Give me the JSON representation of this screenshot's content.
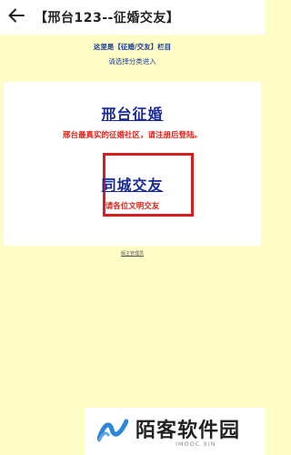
{
  "header": {
    "back_icon": "arrow-left-icon",
    "title": "【邢台123--征婚交友】"
  },
  "intro": {
    "line1": "这里是【征婚/交友】栏目",
    "line2": "请选择分类进入"
  },
  "sections": [
    {
      "title": "邢台征婚",
      "subtitle": "邢台最真实的征婚社区，请注册后登陆。"
    },
    {
      "title": "同城交友",
      "subtitle": "请各位文明交友"
    }
  ],
  "admin_link": "版主管理员",
  "watermark": {
    "name": "陌客软件园",
    "sub": "IMOOC XIN",
    "logo_icon": "wave-logo-icon"
  },
  "colors": {
    "background": "#fffdc6",
    "link_blue": "#1a2a9a",
    "alert_red": "#e2231a",
    "highlight_box": "#d81f1f"
  }
}
